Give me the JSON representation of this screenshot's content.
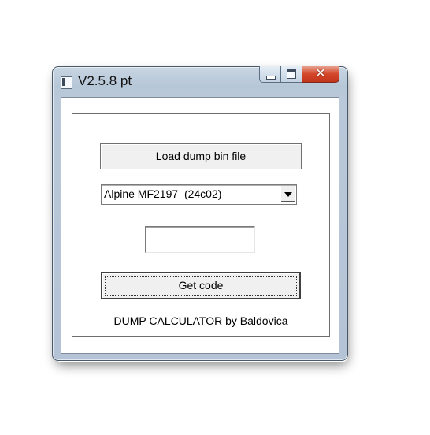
{
  "window": {
    "title": "V2.5.8 pt",
    "caption_buttons": {
      "minimize": "minimize-icon",
      "maximize": "maximize-icon",
      "close": "close-icon",
      "close_glyph": "✕",
      "close_color": "#d3472a"
    }
  },
  "form": {
    "load_button_label": "Load dump bin file",
    "model_select": {
      "selected": "Alpine MF2197  (24c02)"
    },
    "code_field": {
      "value": "",
      "placeholder": ""
    },
    "get_code_button_label": "Get code",
    "credit": "DUMP CALCULATOR by Baldovica"
  }
}
